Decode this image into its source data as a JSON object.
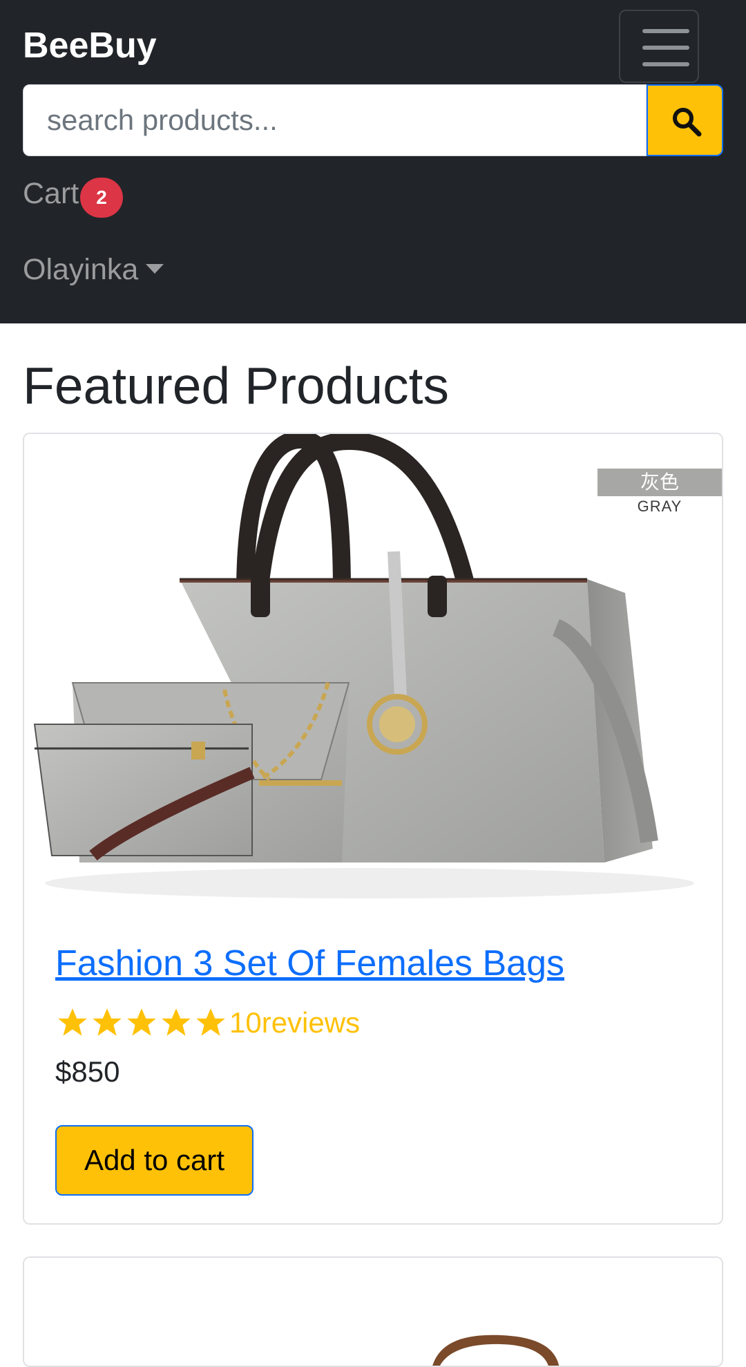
{
  "navbar": {
    "brand": "BeeBuy",
    "menu_icon": "hamburger-menu-icon",
    "search": {
      "placeholder": "search products...",
      "value": "",
      "button_icon": "search-icon"
    },
    "cart": {
      "label": "Cart",
      "count": "2"
    },
    "user": {
      "name": "Olayinka",
      "dropdown_icon": "caret-down-icon"
    }
  },
  "main": {
    "section_title": "Featured Products",
    "products": [
      {
        "image_tag": "灰色",
        "image_tag_sub": "GRAY",
        "title": "Fashion 3 Set Of Females Bags",
        "rating": 5,
        "max_rating": 5,
        "reviews_label": "10reviews",
        "price": "$850",
        "button_label": "Add to cart"
      }
    ]
  },
  "colors": {
    "navbar_bg": "#212529",
    "accent_yellow": "#ffc107",
    "link_blue": "#0d6efd",
    "badge_red": "#dc3545"
  }
}
